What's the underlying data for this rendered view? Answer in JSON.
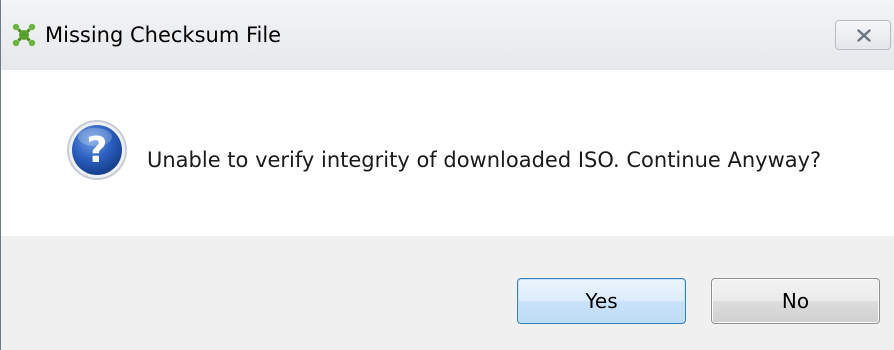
{
  "window": {
    "title": "Missing Checksum File",
    "app_icon": "gecko-paw-icon",
    "close_icon": "close-icon"
  },
  "dialog": {
    "icon": "question-icon",
    "message": "Unable to verify integrity of downloaded ISO. Continue Anyway?"
  },
  "buttons": {
    "yes_label": "Yes",
    "no_label": "No",
    "default": "Yes"
  },
  "colors": {
    "title_bar": "#eceef1",
    "button_bar": "#f0f0f0",
    "default_button_border": "#3c7fb1",
    "question_icon_blue": "#1f4fa3"
  }
}
